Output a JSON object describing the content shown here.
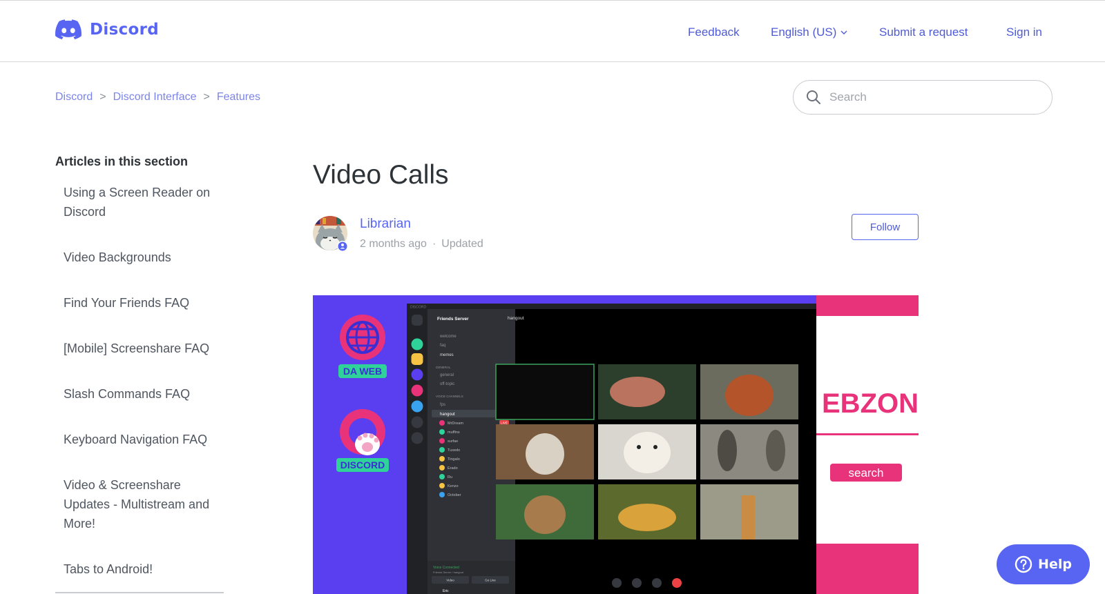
{
  "header": {
    "logo_text": "Discord",
    "nav": {
      "feedback": "Feedback",
      "language": "English (US)",
      "submit_request": "Submit a request",
      "sign_in": "Sign in"
    }
  },
  "breadcrumb": [
    "Discord",
    "Discord Interface",
    "Features"
  ],
  "search": {
    "placeholder": "Search"
  },
  "sidebar": {
    "title": "Articles in this section",
    "items": [
      "Using a Screen Reader on Discord",
      "Video Backgrounds",
      "Find Your Friends FAQ",
      "[Mobile] Screenshare FAQ",
      "Slash Commands FAQ",
      "Keyboard Navigation FAQ",
      "Video & Screenshare Updates - Multistream and More!",
      "Tabs to Android!"
    ]
  },
  "article": {
    "title": "Video Calls",
    "author": "Librarian",
    "time_ago": "2 months ago",
    "updated": "Updated",
    "follow_label": "Follow"
  },
  "hero": {
    "badge_top": "DA WEB",
    "badge_bottom": "DISCORD",
    "window_title": "DISCORD",
    "server_name": "Friends Server",
    "text_channels": [
      "welcome",
      "faq",
      "memes"
    ],
    "general_header": "GENERAL",
    "general_channels": [
      "general",
      "off-topic"
    ],
    "voice_header": "VOICE CHANNELS",
    "voice_channels": [
      "fps",
      "hangout"
    ],
    "voice_users": [
      "MrDream",
      "muffins",
      "surfae",
      "Tuxedo",
      "Tingalo",
      "Erado",
      "Ru",
      "Kenzo",
      "October"
    ],
    "live_badge": "LIVE",
    "call_header": "hangout",
    "voice_connected": "Voice Connected",
    "voice_connected_sub": "Friends Server / hangout",
    "video_button": "Video",
    "golive_button": "Go Live",
    "user_name": "Eric",
    "webzone_text": "EBZONE",
    "search_button": "search"
  },
  "help": {
    "label": "Help"
  },
  "colors": {
    "brand": "#5865f2",
    "hero_bg": "#5a3ff0",
    "pink": "#e8337a"
  }
}
